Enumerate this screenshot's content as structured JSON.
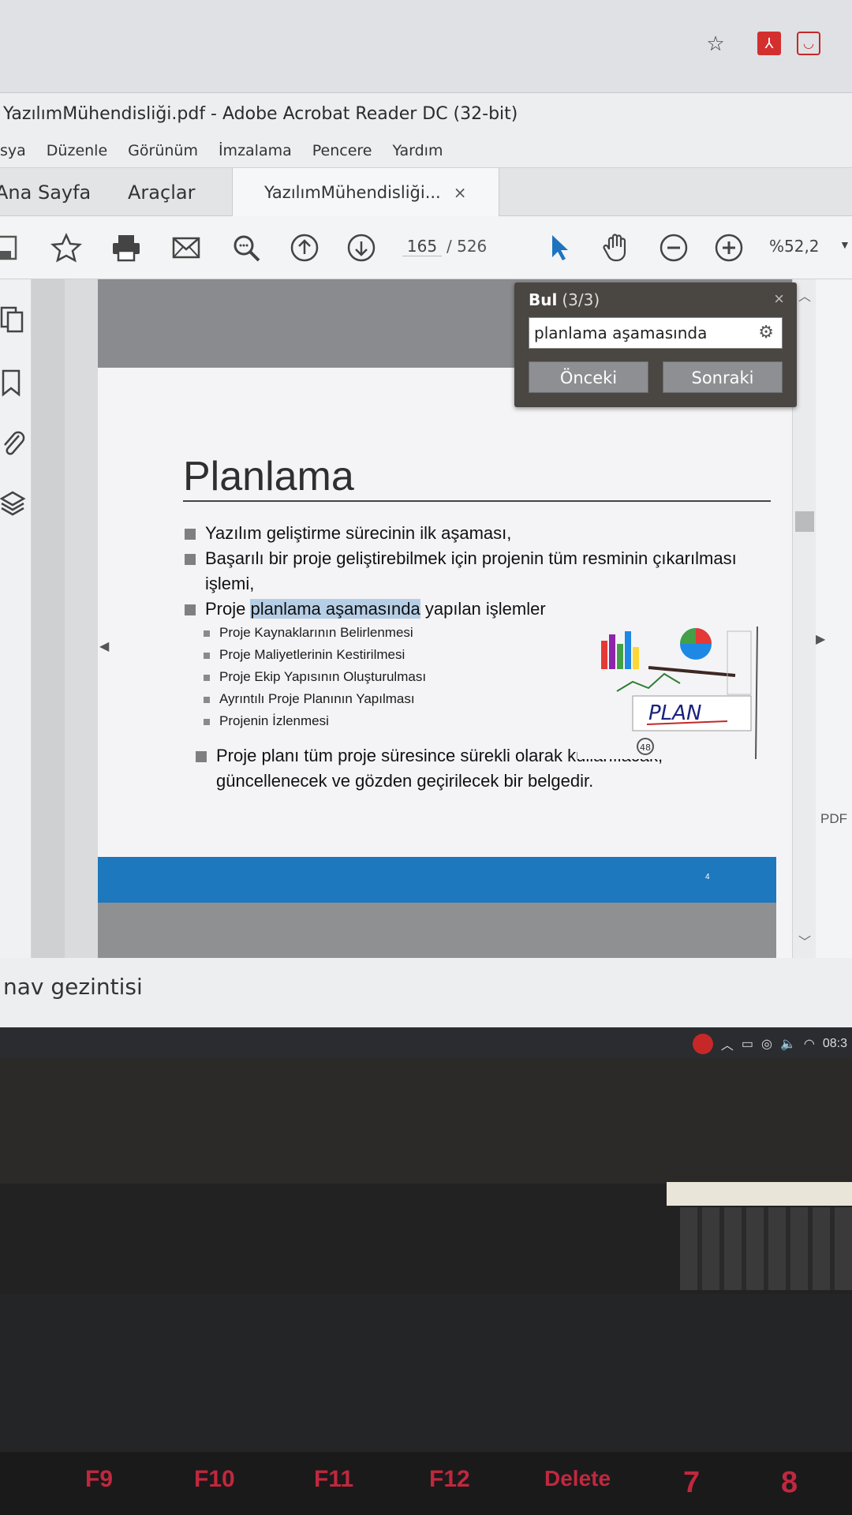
{
  "window_title": "YazılımMühendisliği.pdf - Adobe Acrobat Reader DC (32-bit)",
  "menu": [
    "sya",
    "Düzenle",
    "Görünüm",
    "İmzalama",
    "Pencere",
    "Yardım"
  ],
  "tabs": {
    "home": "Ana Sayfa",
    "tools": "Araçlar",
    "document": "YazılımMühendisliği...",
    "close": "×"
  },
  "toolbar": {
    "page_current": "165",
    "page_total": "/  526",
    "zoom": "%52,2",
    "icons": [
      "save-icon",
      "star-icon",
      "print-icon",
      "email-icon",
      "search-zoom-icon",
      "page-up-icon",
      "page-down-icon",
      "select-arrow-icon",
      "hand-icon",
      "zoom-out-icon",
      "zoom-in-icon"
    ]
  },
  "left_rail_icons": [
    "pages-icon",
    "bookmark-icon",
    "attachment-icon",
    "layers-icon"
  ],
  "find": {
    "label": "Bul",
    "count": "(3/3)",
    "query": "planlama aşamasında",
    "prev": "Önceki",
    "next": "Sonraki",
    "close": "×"
  },
  "slide": {
    "title": "Planlama",
    "bullets": [
      "Yazılım geliştirme sürecinin ilk aşaması,",
      "Başarılı bir proje geliştirebilmek için projenin tüm resminin çıkarılması işlemi,"
    ],
    "b3_pre": "Proje ",
    "b3_hl": "planlama aşamasında",
    "b3_post": " yapılan işlemler",
    "sub_bullets": [
      "Proje Kaynaklarının Belirlenmesi",
      "Proje Maliyetlerinin Kestirilmesi",
      "Proje Ekip Yapısının Oluşturulması",
      "Ayrıntılı Proje Planının Yapılması",
      "Projenin İzlenmesi"
    ],
    "last_bullet": "Proje planı tüm proje süresince sürekli olarak kullanılacak, güncellenecek ve gözden geçirilecek bir belgedir.",
    "image_text": "PLAN",
    "image_badge": "48",
    "page_number": "4"
  },
  "right_label": "PDF",
  "status_text": "nav gezintisi",
  "tray_time": "08:3",
  "fkeys": [
    "F9",
    "F10",
    "F11",
    "F12",
    "Delete",
    "7",
    "8"
  ],
  "colors": {
    "highlight": "#b6cfe6",
    "slide_band": "#1e78bd",
    "find_bg": "#4a4641",
    "select_arrow": "#1e73be"
  }
}
